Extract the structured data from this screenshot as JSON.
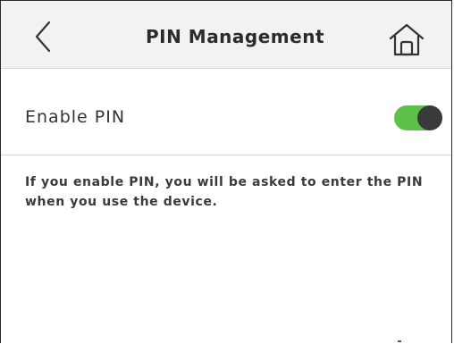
{
  "header": {
    "title": "PIN Management",
    "back_icon": "chevron-left-icon",
    "home_icon": "home-icon"
  },
  "settings": {
    "enable_pin": {
      "label": "Enable PIN",
      "enabled": true,
      "on_color": "#5cc04a",
      "knob_color": "#3a3a3a"
    }
  },
  "description": "If you enable PIN, you will be asked to enter the PIN when you use the device."
}
